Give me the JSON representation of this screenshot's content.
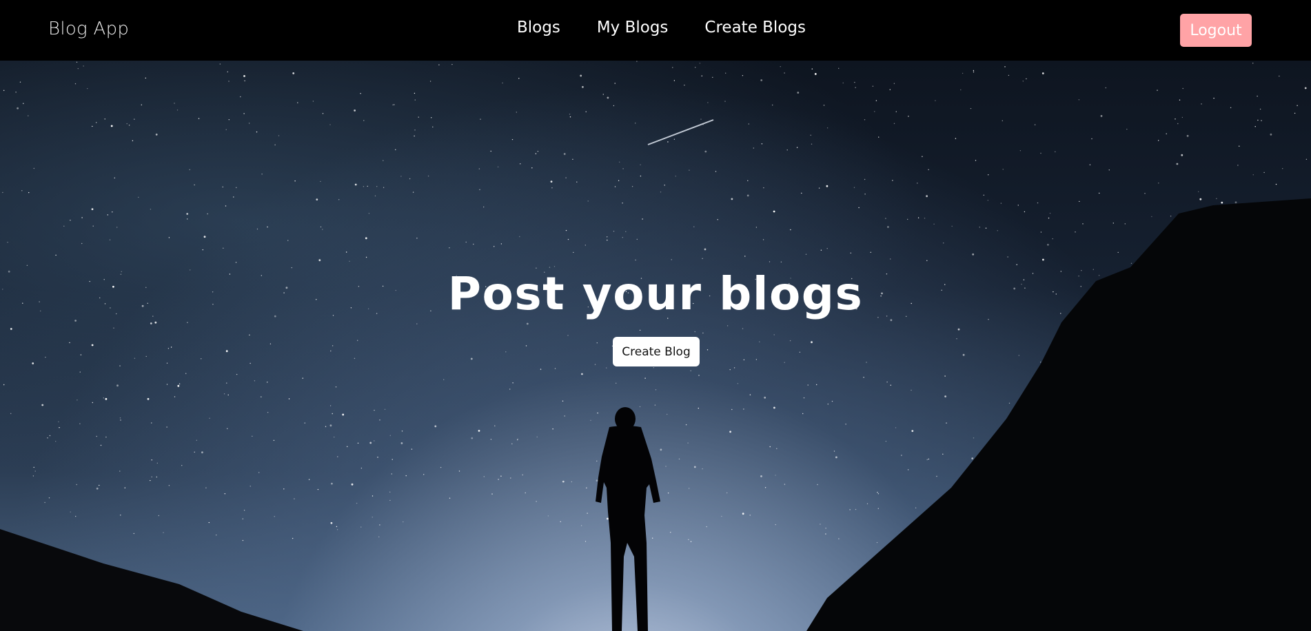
{
  "brand": "Blog App",
  "nav": {
    "links": [
      "Blogs",
      "My Blogs",
      "Create Blogs"
    ],
    "logout_label": "Logout"
  },
  "hero": {
    "title": "Post your blogs",
    "cta_label": "Create Blog"
  },
  "colors": {
    "navbar_bg": "#000000",
    "logout_bg": "#ffa3a6",
    "cta_bg": "#ffffff",
    "text_light": "#ffffff"
  }
}
